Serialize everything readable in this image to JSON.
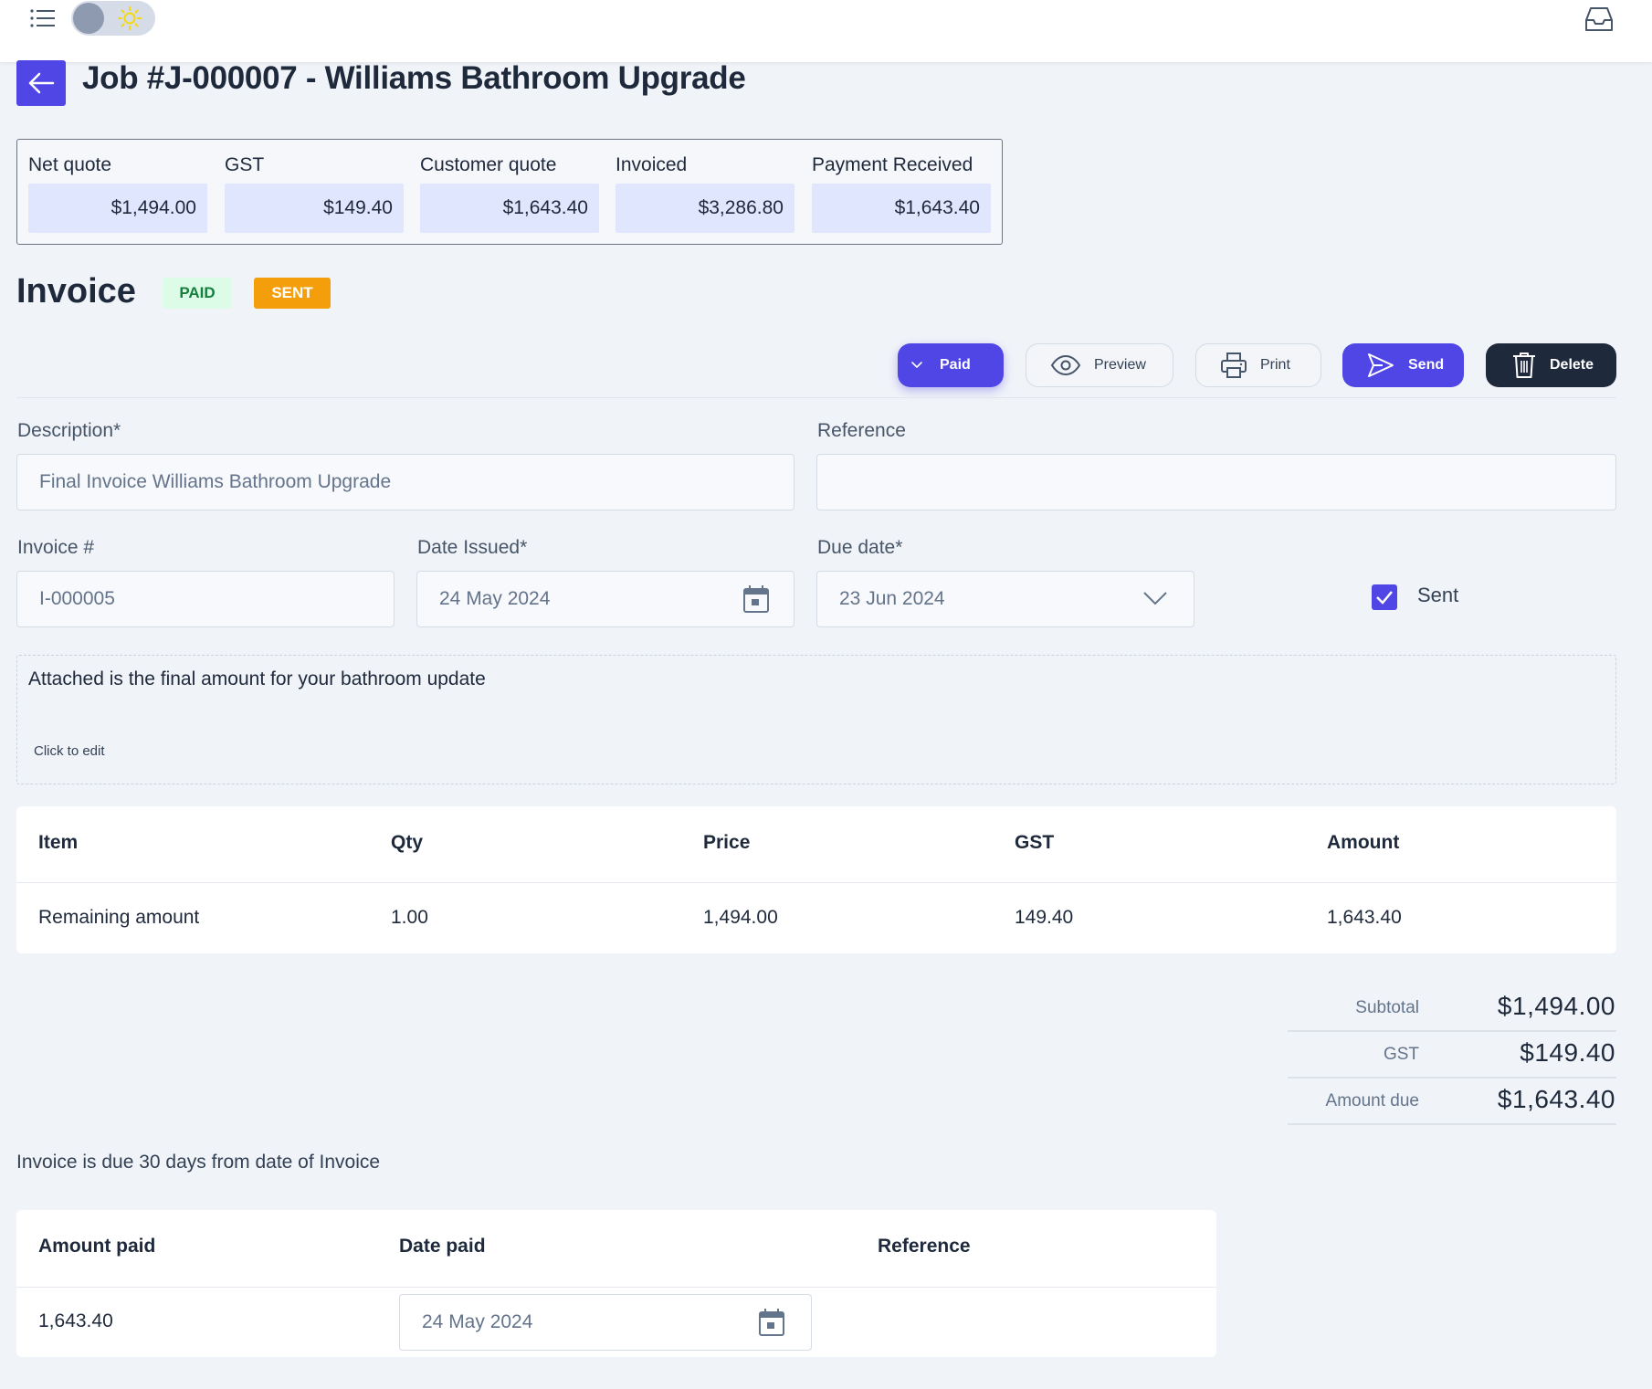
{
  "header": {
    "title": "Job #J-000007 - Williams Bathroom Upgrade"
  },
  "summary": [
    {
      "label": "Net quote",
      "value": "$1,494.00"
    },
    {
      "label": "GST",
      "value": "$149.40"
    },
    {
      "label": "Customer quote",
      "value": "$1,643.40"
    },
    {
      "label": "Invoiced",
      "value": "$3,286.80"
    },
    {
      "label": "Payment Received",
      "value": "$1,643.40"
    }
  ],
  "invoice": {
    "title": "Invoice",
    "badges": {
      "paid": "PAID",
      "sent": "SENT"
    }
  },
  "actions": {
    "paid": "Paid",
    "preview": "Preview",
    "print": "Print",
    "send": "Send",
    "delete": "Delete"
  },
  "form": {
    "description_label": "Description*",
    "description_value": "Final Invoice Williams Bathroom Upgrade",
    "reference_label": "Reference",
    "reference_value": "",
    "invoice_no_label": "Invoice #",
    "invoice_no_value": "I-000005",
    "date_issued_label": "Date Issued*",
    "date_issued_value": "24 May 2024",
    "due_date_label": "Due date*",
    "due_date_value": "23 Jun 2024",
    "sent_label": "Sent",
    "sent_checked": true
  },
  "notes": {
    "text": "Attached is the final amount for your bathroom update",
    "hint": "Click to edit"
  },
  "items_table": {
    "headers": [
      "Item",
      "Qty",
      "Price",
      "GST",
      "Amount"
    ],
    "rows": [
      [
        "Remaining amount",
        "1.00",
        "1,494.00",
        "149.40",
        "1,643.40"
      ]
    ]
  },
  "totals": {
    "subtotal_label": "Subtotal",
    "subtotal_value": "$1,494.00",
    "gst_label": "GST",
    "gst_value": "$149.40",
    "amount_due_label": "Amount due",
    "amount_due_value": "$1,643.40"
  },
  "due_note": "Invoice is due 30 days from date of Invoice",
  "payments_table": {
    "headers": [
      "Amount paid",
      "Date paid",
      "Reference"
    ],
    "rows": [
      {
        "amount": "1,643.40",
        "date": "24 May 2024",
        "reference": ""
      }
    ]
  },
  "colors": {
    "accent": "#4f46e5",
    "dark": "#1e293b",
    "paid_badge_bg": "#dcfce7",
    "sent_badge_bg": "#f59e0b"
  },
  "icons": [
    "menu-icon",
    "theme-toggle",
    "sun-icon",
    "inbox-icon",
    "arrow-left-icon",
    "chevron-down-icon",
    "eye-icon",
    "printer-icon",
    "send-icon",
    "trash-icon",
    "calendar-icon",
    "check-icon"
  ]
}
